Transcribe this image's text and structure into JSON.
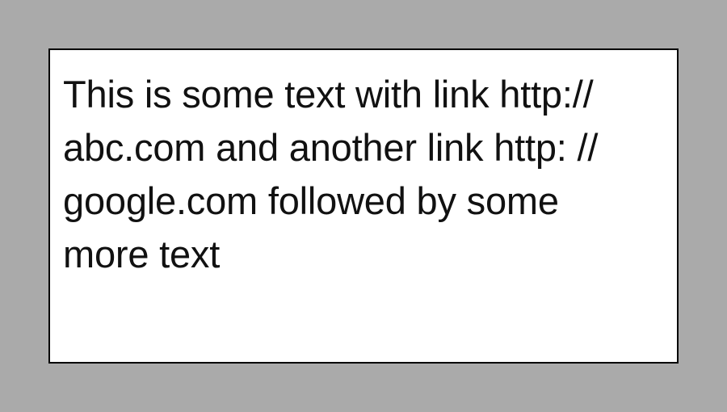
{
  "colors": {
    "background": "#aaaaaa",
    "box_background": "#ffffff",
    "box_border": "#000000",
    "text": "#111111"
  },
  "text_box": {
    "lines": [
      "This is some text with link http://",
      "abc.com and another link http: //",
      "google.com followed by some",
      "more text"
    ]
  }
}
